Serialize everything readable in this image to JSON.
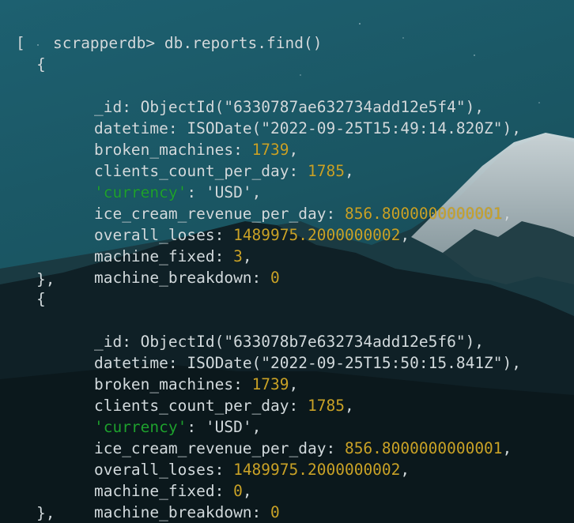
{
  "terminal": {
    "prompt": "scrapperdb> ",
    "command": "db.reports.find()",
    "open_bracket": "[",
    "open_brace": "{",
    "close_brace": "},",
    "records": [
      {
        "id_key": "_id: ",
        "id_value": "ObjectId(\"6330787ae632734add12e5f4\"),",
        "datetime_key": "datetime: ",
        "datetime_value": "ISODate(\"2022-09-25T15:49:14.820Z\"),",
        "broken_key": "broken_machines: ",
        "broken_value": "1739",
        "clients_key": "clients_count_per_day: ",
        "clients_value": "1785",
        "currency_key": "'currency'",
        "currency_sep": ": ",
        "currency_value": "'USD'",
        "revenue_key": "ice_cream_revenue_per_day: ",
        "revenue_value": "856.8000000000001",
        "loses_key": "overall_loses: ",
        "loses_value": "1489975.2000000002",
        "fixed_key": "machine_fixed: ",
        "fixed_value": "3",
        "breakdown_key": "machine_breakdown: ",
        "breakdown_value": "0"
      },
      {
        "id_key": "_id: ",
        "id_value": "ObjectId(\"633078b7e632734add12e5f6\"),",
        "datetime_key": "datetime: ",
        "datetime_value": "ISODate(\"2022-09-25T15:50:15.841Z\"),",
        "broken_key": "broken_machines: ",
        "broken_value": "1739",
        "clients_key": "clients_count_per_day: ",
        "clients_value": "1785",
        "currency_key": "'currency'",
        "currency_sep": ": ",
        "currency_value": "'USD'",
        "revenue_key": "ice_cream_revenue_per_day: ",
        "revenue_value": "856.8000000000001",
        "loses_key": "overall_loses: ",
        "loses_value": "1489975.2000000002",
        "fixed_key": "machine_fixed: ",
        "fixed_value": "0",
        "breakdown_key": "machine_breakdown: ",
        "breakdown_value": "0"
      }
    ],
    "comma": ","
  },
  "colors": {
    "text": "#d2dadd",
    "number": "#c9a227",
    "quoted_key": "#1ea12e",
    "background_sky": "#1b5a66",
    "background_mountain": "#0d1c21"
  }
}
